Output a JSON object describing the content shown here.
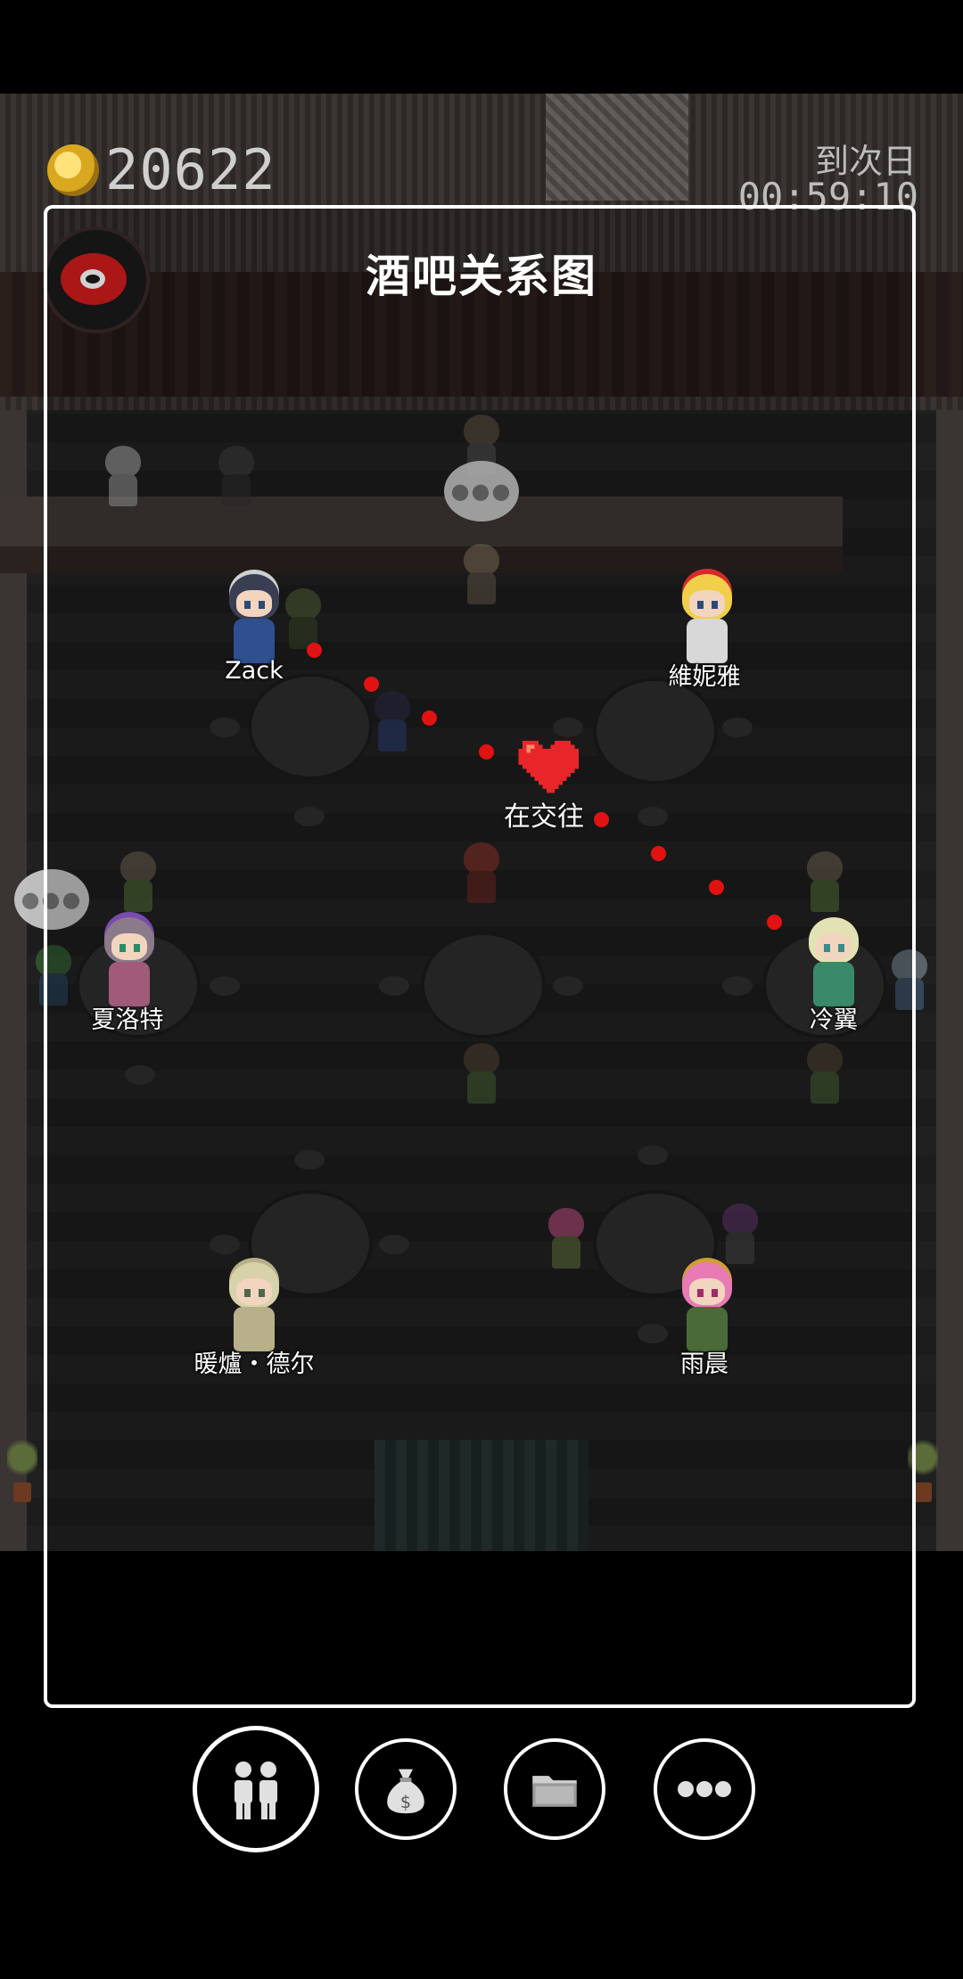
{
  "hud": {
    "coins": "20622",
    "next_day_label": "到次日",
    "timer": "00:59:10",
    "weibo_icon": "weibo-icon",
    "coin_icon": "gold-coin-icon"
  },
  "panel": {
    "title": "酒吧关系图"
  },
  "characters": {
    "zack": "Zack",
    "veniya": "維妮雅",
    "charlotte": "夏洛特",
    "lengyi": "冷翼",
    "nuanlu": "暖爐・德尔",
    "yuchen": "雨晨"
  },
  "relationships": [
    {
      "from": "Zack",
      "to": "冷翼",
      "status": "在交往",
      "icon": "heart-icon",
      "color": "#e01212"
    }
  ],
  "toolbar": {
    "items": [
      {
        "icon": "people-icon"
      },
      {
        "icon": "money-bag-icon"
      },
      {
        "icon": "folder-icon"
      },
      {
        "icon": "more-icon"
      }
    ]
  },
  "colors": {
    "panel_border": "#ffffff",
    "relation_dot": "#e01212",
    "background": "#000000"
  }
}
